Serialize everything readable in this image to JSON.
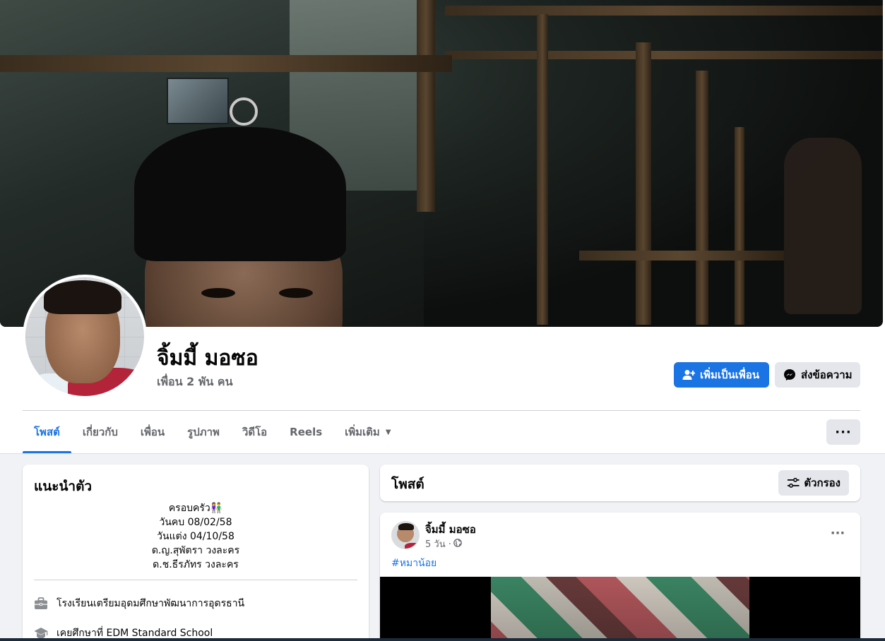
{
  "profile": {
    "name": "จิ้มมี้ มอซอ",
    "friends_count": "เพื่อน 2 พัน คน"
  },
  "actions": {
    "add_friend": "เพิ่มเป็นเพื่อน",
    "message": "ส่งข้อความ"
  },
  "tabs": [
    {
      "label": "โพสต์",
      "active": true
    },
    {
      "label": "เกี่ยวกับ",
      "active": false
    },
    {
      "label": "เพื่อน",
      "active": false
    },
    {
      "label": "รูปภาพ",
      "active": false
    },
    {
      "label": "วิดีโอ",
      "active": false
    },
    {
      "label": "Reels",
      "active": false
    },
    {
      "label": "เพิ่มเติม",
      "active": false
    }
  ],
  "more_button": "···",
  "intro": {
    "title": "แนะนำตัว",
    "bio": [
      "ครอบครัว👫",
      "วันคบ 08/02/58",
      "วันแต่ง 04/10/58",
      "ด.ญ.สุพัตรา วงละคร",
      "ด.ช.ธีรภัทร วงละคร"
    ],
    "items": [
      {
        "icon": "briefcase-icon",
        "text": "โรงเรียนเตรียมอุดมศึกษาพัฒนาการอุดรธานี"
      },
      {
        "icon": "graduation-cap-icon",
        "text": "เคยศึกษาที่ EDM Standard School"
      }
    ]
  },
  "posts": {
    "title": "โพสต์",
    "filter_label": "ตัวกรอง",
    "post": {
      "author": "จิ้มมี้ มอซอ",
      "time": "5 วัน ·",
      "audience_icon": "globe-icon",
      "hashtag": "#หมาน้อย",
      "menu": "···"
    }
  },
  "colors": {
    "accent": "#1b74e4",
    "secondary_button": "#e4e6eb",
    "background": "#f0f2f5",
    "muted_text": "#65676b"
  }
}
